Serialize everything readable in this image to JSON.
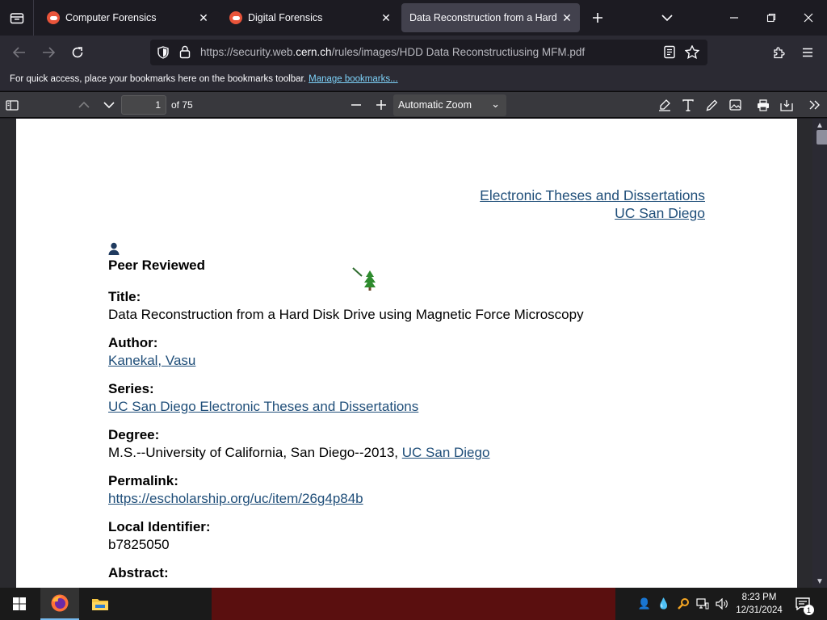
{
  "tabs": [
    {
      "title": "Computer Forensics",
      "active": false
    },
    {
      "title": "Digital Forensics",
      "active": false
    },
    {
      "title": "Data Reconstruction from a Hard Disk Drive",
      "active": true
    }
  ],
  "navbar": {
    "url_prefix": "https://security.web.",
    "url_domain": "cern.ch",
    "url_suffix": "/rules/images/HDD Data Reconstructiusing MFM.pdf"
  },
  "bookmarks_bar": {
    "message": "For quick access, place your bookmarks here on the bookmarks toolbar.",
    "manage_link": "Manage bookmarks..."
  },
  "pdf_toolbar": {
    "page_number": "1",
    "page_count": "of 75",
    "zoom": "Automatic Zoom"
  },
  "document": {
    "header_link_1": "Electronic Theses and Dissertations",
    "header_link_2": "UC San Diego",
    "peer_reviewed": "Peer Reviewed",
    "title_label": "Title:",
    "title_value": "Data Reconstruction from a Hard Disk Drive using Magnetic Force Microscopy",
    "author_label": "Author:",
    "author_value": "Kanekal, Vasu",
    "series_label": "Series:",
    "series_value": "UC San Diego Electronic Theses and Dissertations",
    "degree_label": "Degree:",
    "degree_text": "M.S.--University of California, San Diego--2013, ",
    "degree_link": "UC San Diego",
    "permalink_label": "Permalink:",
    "permalink_value": "https://escholarship.org/uc/item/26g4p84b",
    "local_id_label": "Local Identifier:",
    "local_id_value": "b7825050",
    "abstract_label": "Abstract:"
  },
  "taskbar": {
    "time": "8:23 PM",
    "date": "12/31/2024",
    "notification_count": "1"
  },
  "colors": {
    "browser_bg": "#1c1b22",
    "toolbar_bg": "#2b2a33",
    "pdf_toolbar_bg": "#38383d",
    "link": "#1f4e79",
    "bookmark_link": "#7dd1f8"
  }
}
